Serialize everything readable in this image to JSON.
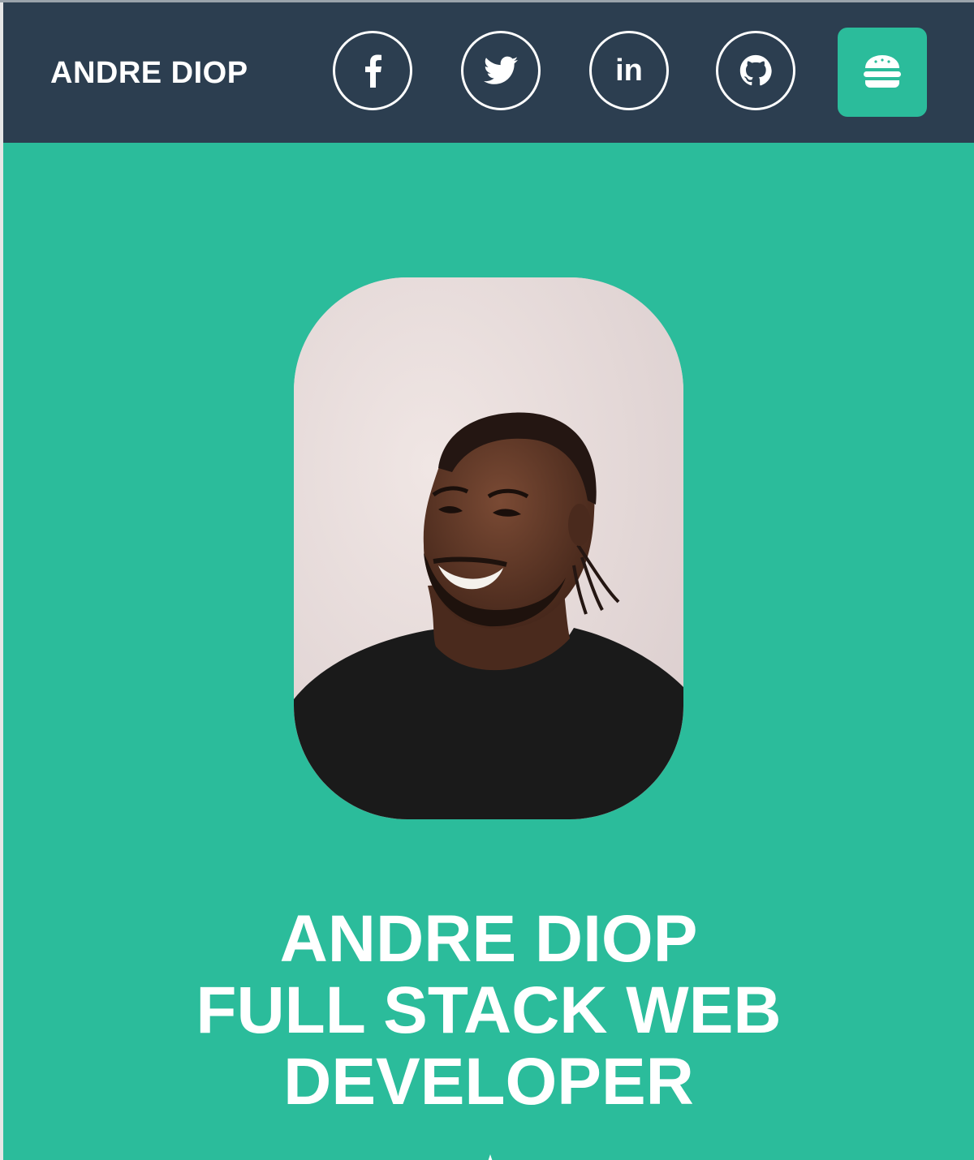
{
  "nav": {
    "brand": "ANDRE DIOP",
    "social": [
      {
        "name": "facebook",
        "icon": "facebook-icon"
      },
      {
        "name": "twitter",
        "icon": "twitter-icon"
      },
      {
        "name": "linkedin",
        "icon": "linkedin-icon",
        "glyph": "in"
      },
      {
        "name": "github",
        "icon": "github-icon"
      }
    ],
    "menu_icon": "hamburger-menu-icon"
  },
  "hero": {
    "title_lines": [
      "ANDRE DIOP",
      "FULL STACK WEB",
      "DEVELOPER"
    ]
  },
  "colors": {
    "navbar": "#2c3e50",
    "accent": "#2bbc9b",
    "text": "#ffffff"
  }
}
